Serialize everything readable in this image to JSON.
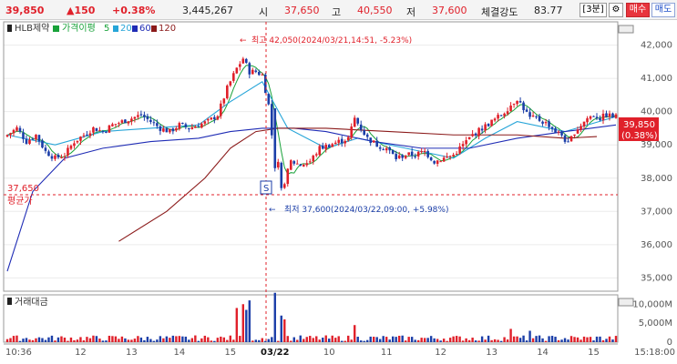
{
  "header": {
    "price": "39,850",
    "change": "▲150",
    "change_pct": "+0.38%",
    "volume": "3,445,267",
    "open_label": "시",
    "open_value": "37,650",
    "high_label": "고",
    "high_value": "40,550",
    "low_label": "저",
    "low_value": "37,600",
    "strength_label": "체결강도",
    "strength_value": "83.77",
    "interval": "[3분]",
    "settings_icon": "gear-icon",
    "buy_label": "매수",
    "sell_label": "매도"
  },
  "legend": {
    "stock": "HLB제약",
    "ma_label": "가격이평",
    "ma": [
      {
        "period": "5",
        "color": "#19a23a"
      },
      {
        "period": "20",
        "color": "#27a5d8"
      },
      {
        "period": "60",
        "color": "#1f2cb5"
      },
      {
        "period": "120",
        "color": "#8b1a1a"
      }
    ]
  },
  "annotations": {
    "high_note": "최고 42,050(2024/03/21,14:51, -5.23%)",
    "low_note": "최저 37,600(2024/03/22,09:00, +5.98%)",
    "avg_price": "37,650",
    "avg_label": "평균가",
    "current_price": "39,850",
    "current_pct": "(0.38%)",
    "marker": "S"
  },
  "volume_panel": {
    "title": "거래대금",
    "ticks": [
      "10,000M",
      "5,000M",
      "0"
    ]
  },
  "chart_data": {
    "type": "candlestick",
    "price_axis_ticks": [
      42000,
      41000,
      40000,
      39000,
      38000,
      37000,
      36000,
      35000
    ],
    "ylim": [
      34600,
      42700
    ],
    "x_tick_labels": [
      "10:36",
      "12",
      "13",
      "14",
      "15",
      "03/22",
      "10",
      "11",
      "12",
      "13",
      "14",
      "15",
      "15:18:00"
    ],
    "anchors": [
      [
        0,
        39300
      ],
      [
        3,
        39500
      ],
      [
        6,
        39100
      ],
      [
        9,
        39300
      ],
      [
        12,
        38800
      ],
      [
        15,
        38600
      ],
      [
        18,
        38700
      ],
      [
        21,
        39100
      ],
      [
        24,
        39300
      ],
      [
        27,
        39500
      ],
      [
        30,
        39400
      ],
      [
        33,
        39600
      ],
      [
        36,
        39700
      ],
      [
        39,
        39800
      ],
      [
        42,
        39900
      ],
      [
        45,
        39700
      ],
      [
        48,
        39500
      ],
      [
        51,
        39400
      ],
      [
        54,
        39600
      ],
      [
        57,
        39500
      ],
      [
        60,
        39600
      ],
      [
        63,
        39700
      ],
      [
        66,
        39900
      ],
      [
        69,
        40700
      ],
      [
        72,
        41300
      ],
      [
        74,
        41600
      ],
      [
        76,
        41200
      ],
      [
        78,
        41200
      ],
      [
        80,
        41100
      ],
      [
        82,
        40200
      ],
      [
        83,
        39300
      ],
      [
        84,
        38700
      ],
      [
        85,
        38400
      ],
      [
        87,
        37900
      ],
      [
        89,
        38500
      ],
      [
        92,
        38400
      ],
      [
        95,
        38500
      ],
      [
        98,
        38900
      ],
      [
        101,
        39000
      ],
      [
        104,
        39100
      ],
      [
        107,
        39200
      ],
      [
        109,
        39800
      ],
      [
        111,
        39500
      ],
      [
        113,
        39200
      ],
      [
        116,
        39000
      ],
      [
        119,
        38900
      ],
      [
        122,
        38600
      ],
      [
        125,
        38700
      ],
      [
        128,
        38700
      ],
      [
        131,
        38800
      ],
      [
        134,
        38500
      ],
      [
        137,
        38600
      ],
      [
        140,
        38700
      ],
      [
        143,
        39000
      ],
      [
        146,
        39300
      ],
      [
        149,
        39500
      ],
      [
        152,
        39700
      ],
      [
        155,
        39900
      ],
      [
        158,
        40200
      ],
      [
        160,
        40400
      ],
      [
        162,
        40100
      ],
      [
        164,
        39800
      ],
      [
        166,
        39800
      ],
      [
        168,
        39700
      ],
      [
        170,
        39600
      ],
      [
        172,
        39400
      ],
      [
        174,
        39300
      ],
      [
        176,
        39000
      ],
      [
        178,
        39400
      ],
      [
        180,
        39600
      ],
      [
        182,
        39800
      ],
      [
        184,
        39900
      ],
      [
        186,
        39800
      ],
      [
        188,
        39900
      ],
      [
        190,
        39850
      ],
      [
        191,
        39850
      ]
    ],
    "ma_curves": {
      "ma20": [
        [
          0,
          39300
        ],
        [
          15,
          39000
        ],
        [
          30,
          39400
        ],
        [
          45,
          39500
        ],
        [
          60,
          39600
        ],
        [
          70,
          40300
        ],
        [
          80,
          40900
        ],
        [
          88,
          39500
        ],
        [
          100,
          38900
        ],
        [
          110,
          39200
        ],
        [
          125,
          38900
        ],
        [
          140,
          38600
        ],
        [
          150,
          39200
        ],
        [
          160,
          39700
        ],
        [
          175,
          39400
        ],
        [
          191,
          39850
        ]
      ],
      "ma60": [
        [
          0,
          35200
        ],
        [
          8,
          37600
        ],
        [
          18,
          38600
        ],
        [
          30,
          38900
        ],
        [
          45,
          39100
        ],
        [
          60,
          39200
        ],
        [
          70,
          39400
        ],
        [
          80,
          39500
        ],
        [
          90,
          39500
        ],
        [
          100,
          39400
        ],
        [
          115,
          39100
        ],
        [
          130,
          38900
        ],
        [
          145,
          38900
        ],
        [
          160,
          39200
        ],
        [
          175,
          39400
        ],
        [
          191,
          39600
        ]
      ],
      "ma120": [
        [
          35,
          36100
        ],
        [
          50,
          37000
        ],
        [
          62,
          38000
        ],
        [
          70,
          38900
        ],
        [
          78,
          39400
        ],
        [
          85,
          39500
        ],
        [
          100,
          39500
        ],
        [
          120,
          39400
        ],
        [
          140,
          39300
        ],
        [
          160,
          39300
        ],
        [
          175,
          39200
        ],
        [
          185,
          39250
        ]
      ]
    },
    "ma5_color": "#19a23a",
    "ma20_color": "#27a5d8",
    "ma60_color": "#1f2cb5",
    "ma120_color": "#8b1a1a",
    "up_color": "#e0202a",
    "down_color": "#1b3ea8",
    "volume_spikes": [
      [
        72,
        9
      ],
      [
        74,
        10
      ],
      [
        75,
        8.5
      ],
      [
        76,
        11
      ],
      [
        84,
        13
      ],
      [
        86,
        7
      ],
      [
        87,
        6
      ],
      [
        109,
        4.5
      ],
      [
        158,
        3.5
      ],
      [
        164,
        3
      ]
    ]
  }
}
